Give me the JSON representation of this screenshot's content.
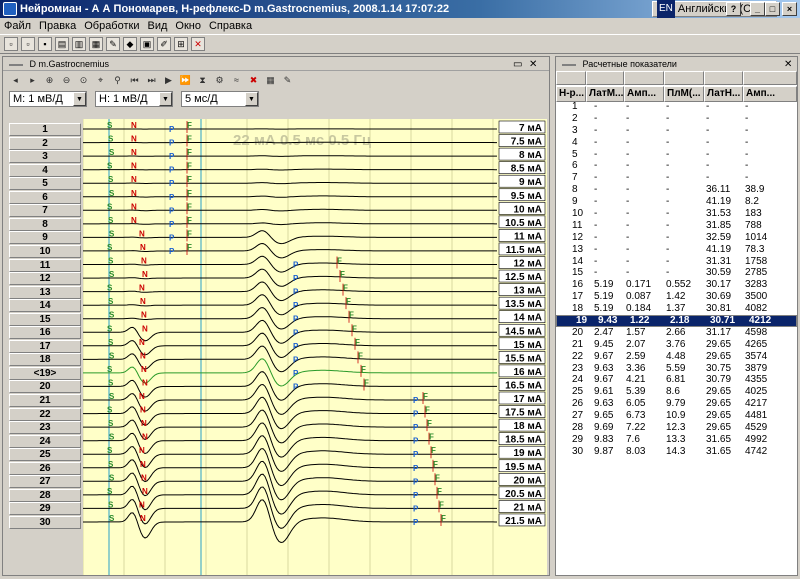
{
  "window": {
    "title": "Нейромиан - А А Пономарев, Н-рефлекс-D  m.Gastrocnemius, 2008.1.14 17:07:22",
    "lang_code": "EN",
    "lang_name": "Английский (США)",
    "help": "?",
    "min": "_",
    "max": "□",
    "close": "×"
  },
  "menu": [
    "Файл",
    "Правка",
    "Обработки",
    "Вид",
    "Окно",
    "Справка"
  ],
  "left_panel": {
    "title": "D  m.Gastrocnemius",
    "select_m": "M: 1 мВ/Д",
    "select_h": "H: 1 мВ/Д",
    "select_t": "5 мс/Д",
    "overlay": "22 мА  0.5 мс  0.5 Гц",
    "rows": [
      "1",
      "2",
      "3",
      "4",
      "5",
      "6",
      "7",
      "8",
      "9",
      "10",
      "11",
      "12",
      "13",
      "14",
      "15",
      "16",
      "17",
      "18",
      "<19>",
      "20",
      "21",
      "22",
      "23",
      "24",
      "25",
      "26",
      "27",
      "28",
      "29",
      "30"
    ],
    "currents": [
      "7 мА",
      "7.5 мА",
      "8 мА",
      "8.5 мА",
      "9 мА",
      "9.5 мА",
      "10 мА",
      "10.5 мА",
      "11 мА",
      "11.5 мА",
      "12 мА",
      "12.5 мА",
      "13 мА",
      "13.5 мА",
      "14 мА",
      "14.5 мА",
      "15 мА",
      "15.5 мА",
      "16 мА",
      "16.5 мА",
      "17 мА",
      "17.5 мА",
      "18 мА",
      "18.5 мА",
      "19 мА",
      "19.5 мА",
      "20 мА",
      "20.5 мА",
      "21 мА",
      "21.5 мА"
    ],
    "markers": {
      "s": "S",
      "n": "N",
      "p": "P",
      "f": "F"
    }
  },
  "right_panel": {
    "title": "Расчетные показатели",
    "headers": [
      "Н-р...",
      "ЛатМ...",
      "Амп...",
      "ПлМ(...",
      "ЛатН...",
      "Амп..."
    ],
    "rows": [
      [
        "1",
        "-",
        "-",
        "-",
        "-",
        "-"
      ],
      [
        "2",
        "-",
        "-",
        "-",
        "-",
        "-"
      ],
      [
        "3",
        "-",
        "-",
        "-",
        "-",
        "-"
      ],
      [
        "4",
        "-",
        "-",
        "-",
        "-",
        "-"
      ],
      [
        "5",
        "-",
        "-",
        "-",
        "-",
        "-"
      ],
      [
        "6",
        "-",
        "-",
        "-",
        "-",
        "-"
      ],
      [
        "7",
        "-",
        "-",
        "-",
        "-",
        "-"
      ],
      [
        "8",
        "-",
        "-",
        "-",
        "36.11",
        "38.9"
      ],
      [
        "9",
        "-",
        "-",
        "-",
        "41.19",
        "8.2"
      ],
      [
        "10",
        "-",
        "-",
        "-",
        "31.53",
        "183"
      ],
      [
        "11",
        "-",
        "-",
        "-",
        "31.85",
        "788"
      ],
      [
        "12",
        "-",
        "-",
        "-",
        "32.59",
        "1014"
      ],
      [
        "13",
        "-",
        "-",
        "-",
        "41.19",
        "78.3"
      ],
      [
        "14",
        "-",
        "-",
        "-",
        "31.31",
        "1758"
      ],
      [
        "15",
        "-",
        "-",
        "-",
        "30.59",
        "2785"
      ],
      [
        "16",
        "5.19",
        "0.171",
        "0.552",
        "30.17",
        "3283"
      ],
      [
        "17",
        "5.19",
        "0.087",
        "1.42",
        "30.69",
        "3500"
      ],
      [
        "18",
        "5.19",
        "0.184",
        "1.37",
        "30.81",
        "4082"
      ],
      [
        "19",
        "9.43",
        "1.22",
        "2.18",
        "30.71",
        "4212"
      ],
      [
        "20",
        "2.47",
        "1.57",
        "2.66",
        "31.17",
        "4598"
      ],
      [
        "21",
        "9.45",
        "2.07",
        "3.76",
        "29.65",
        "4265"
      ],
      [
        "22",
        "9.67",
        "2.59",
        "4.48",
        "29.65",
        "3574"
      ],
      [
        "23",
        "9.63",
        "3.36",
        "5.59",
        "30.75",
        "3879"
      ],
      [
        "24",
        "9.67",
        "4.21",
        "6.81",
        "30.79",
        "4355"
      ],
      [
        "25",
        "9.61",
        "5.39",
        "8.6",
        "29.65",
        "4025"
      ],
      [
        "26",
        "9.63",
        "6.05",
        "9.79",
        "29.65",
        "4217"
      ],
      [
        "27",
        "9.65",
        "6.73",
        "10.9",
        "29.65",
        "4481"
      ],
      [
        "28",
        "9.69",
        "7.22",
        "12.3",
        "29.65",
        "4529"
      ],
      [
        "29",
        "9.83",
        "7.6",
        "13.3",
        "31.65",
        "4992"
      ],
      [
        "30",
        "9.87",
        "8.03",
        "14.3",
        "31.65",
        "4742"
      ]
    ],
    "selected_row": 18
  }
}
